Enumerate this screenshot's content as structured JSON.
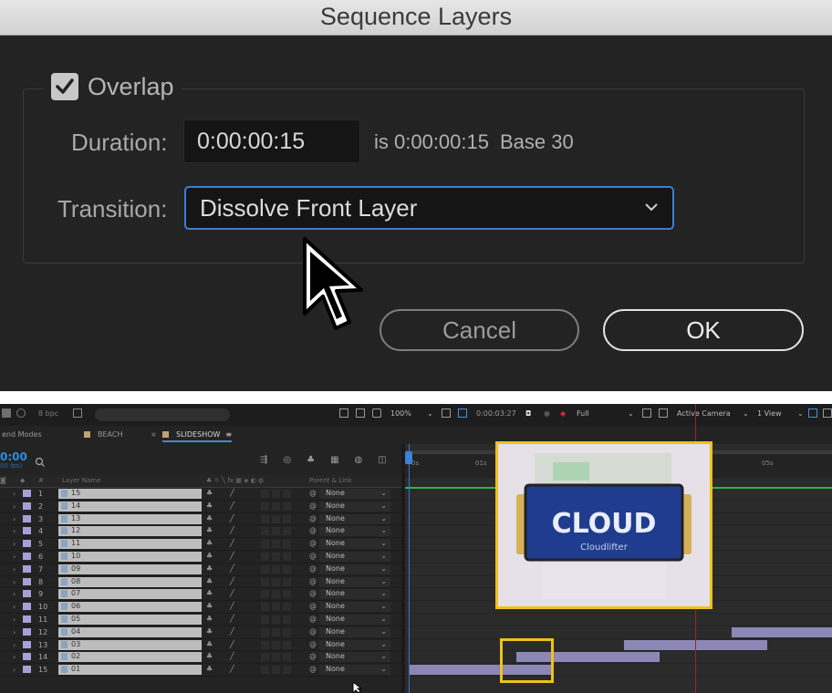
{
  "dialog": {
    "title": "Sequence Layers",
    "overlap_label": "Overlap",
    "overlap_checked": true,
    "duration_label": "Duration:",
    "duration_value": "0:00:00:15",
    "duration_info": "is 0:00:00:15",
    "base_info": "Base 30",
    "transition_label": "Transition:",
    "transition_value": "Dissolve Front Layer",
    "cancel_label": "Cancel",
    "ok_label": "OK"
  },
  "ae": {
    "toolbar": {
      "bpc": "8 bpc",
      "zoom": "100%",
      "timecode": "0:00:03:27",
      "resolution": "Full",
      "camera": "Active Camera",
      "views": "1 View"
    },
    "left_label": "end Modes",
    "tabs": [
      {
        "label": "BEACH",
        "active": false
      },
      {
        "label": "SLIDESHOW",
        "active": true
      }
    ],
    "timecode": "0:00",
    "fps": "00 fps)",
    "columns": {
      "num": "#",
      "layer_name": "Layer Name",
      "parent": "Parent & Link"
    },
    "layers": [
      {
        "num": "1",
        "name": "15",
        "parent": "None"
      },
      {
        "num": "2",
        "name": "14",
        "parent": "None"
      },
      {
        "num": "3",
        "name": "13",
        "parent": "None"
      },
      {
        "num": "4",
        "name": "12",
        "parent": "None"
      },
      {
        "num": "5",
        "name": "11",
        "parent": "None"
      },
      {
        "num": "6",
        "name": "10",
        "parent": "None"
      },
      {
        "num": "7",
        "name": "09",
        "parent": "None"
      },
      {
        "num": "8",
        "name": "08",
        "parent": "None"
      },
      {
        "num": "9",
        "name": "07",
        "parent": "None"
      },
      {
        "num": "10",
        "name": "06",
        "parent": "None"
      },
      {
        "num": "11",
        "name": "05",
        "parent": "None"
      },
      {
        "num": "12",
        "name": "04",
        "parent": "None"
      },
      {
        "num": "13",
        "name": "03",
        "parent": "None"
      },
      {
        "num": "14",
        "name": "02",
        "parent": "None"
      },
      {
        "num": "15",
        "name": "01",
        "parent": "None"
      }
    ],
    "ruler": [
      "0s",
      "01s",
      "05s"
    ],
    "preview": {
      "brand": "CLOUD",
      "product": "Cloudlifter"
    }
  }
}
